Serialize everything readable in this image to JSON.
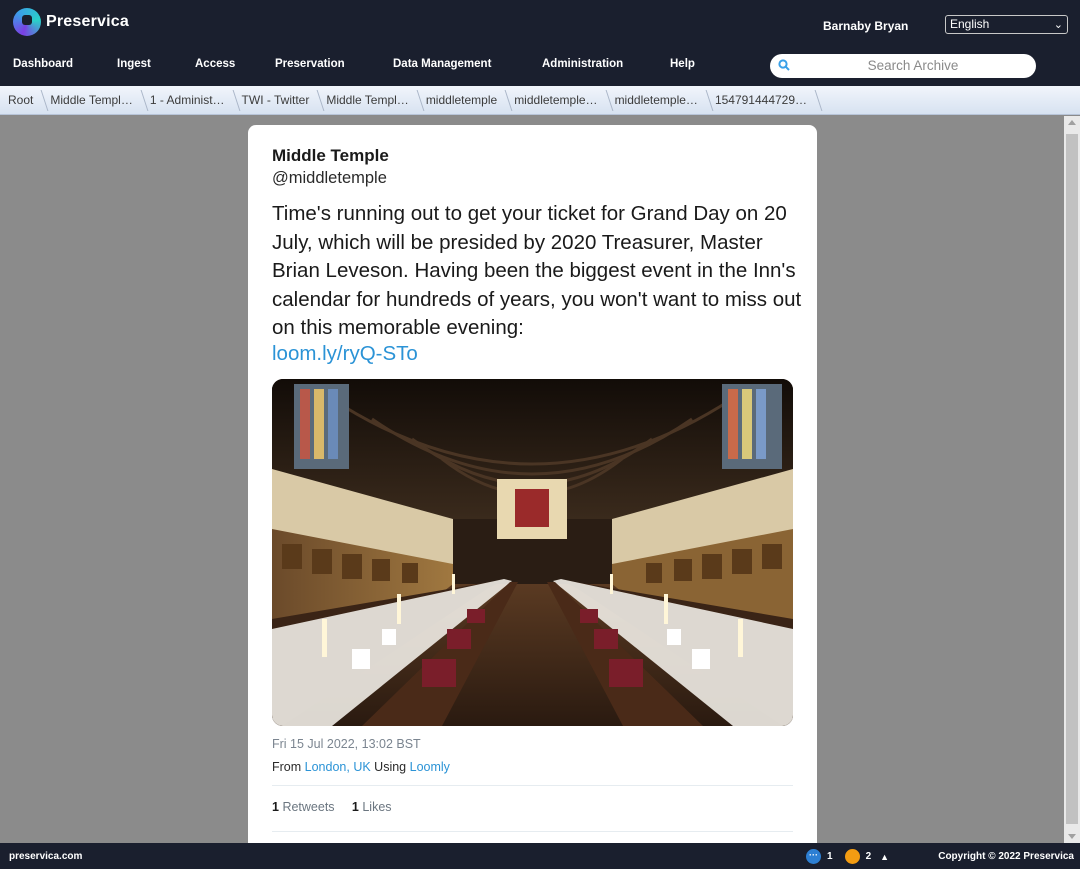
{
  "app": {
    "name": "Preservica",
    "user": "Barnaby Bryan",
    "language": "English"
  },
  "nav": {
    "items": [
      "Dashboard",
      "Ingest",
      "Access",
      "Preservation",
      "Data Management",
      "Administration",
      "Help"
    ]
  },
  "search": {
    "placeholder": "Search Archive"
  },
  "breadcrumb": [
    "Root",
    "Middle Templ…",
    "1 - Administ…",
    "TWI - Twitter",
    "Middle Templ…",
    "middletemple",
    "middletemple…",
    "middletemple…",
    "154791444729…"
  ],
  "tweet": {
    "author_name": "Middle Temple",
    "author_handle": "@middletemple",
    "text": "Time's running out to get your ticket for Grand Day on 20 July, which will be presided by 2020 Treasurer, Master Brian Leveson. Having been the biggest event in the Inn's calendar for hundreds of years, you won't want to miss out on this memorable evening:",
    "link": "loom.ly/ryQ-STo",
    "timestamp": "Fri 15 Jul 2022, 13:02 BST",
    "from_label": "From",
    "location": "London, UK",
    "using_label": "Using",
    "client": "Loomly",
    "retweets_count": "1",
    "retweets_label": "Retweets",
    "likes_count": "1",
    "likes_label": "Likes"
  },
  "footer": {
    "site": "preservica.com",
    "copyright": "Copyright © 2022 Preservica",
    "status_blue_count": "1",
    "status_orange_count": "2"
  },
  "colors": {
    "header_bg": "#1a1f2e",
    "link": "#2b93d6",
    "content_bg": "#8b8b8b"
  }
}
